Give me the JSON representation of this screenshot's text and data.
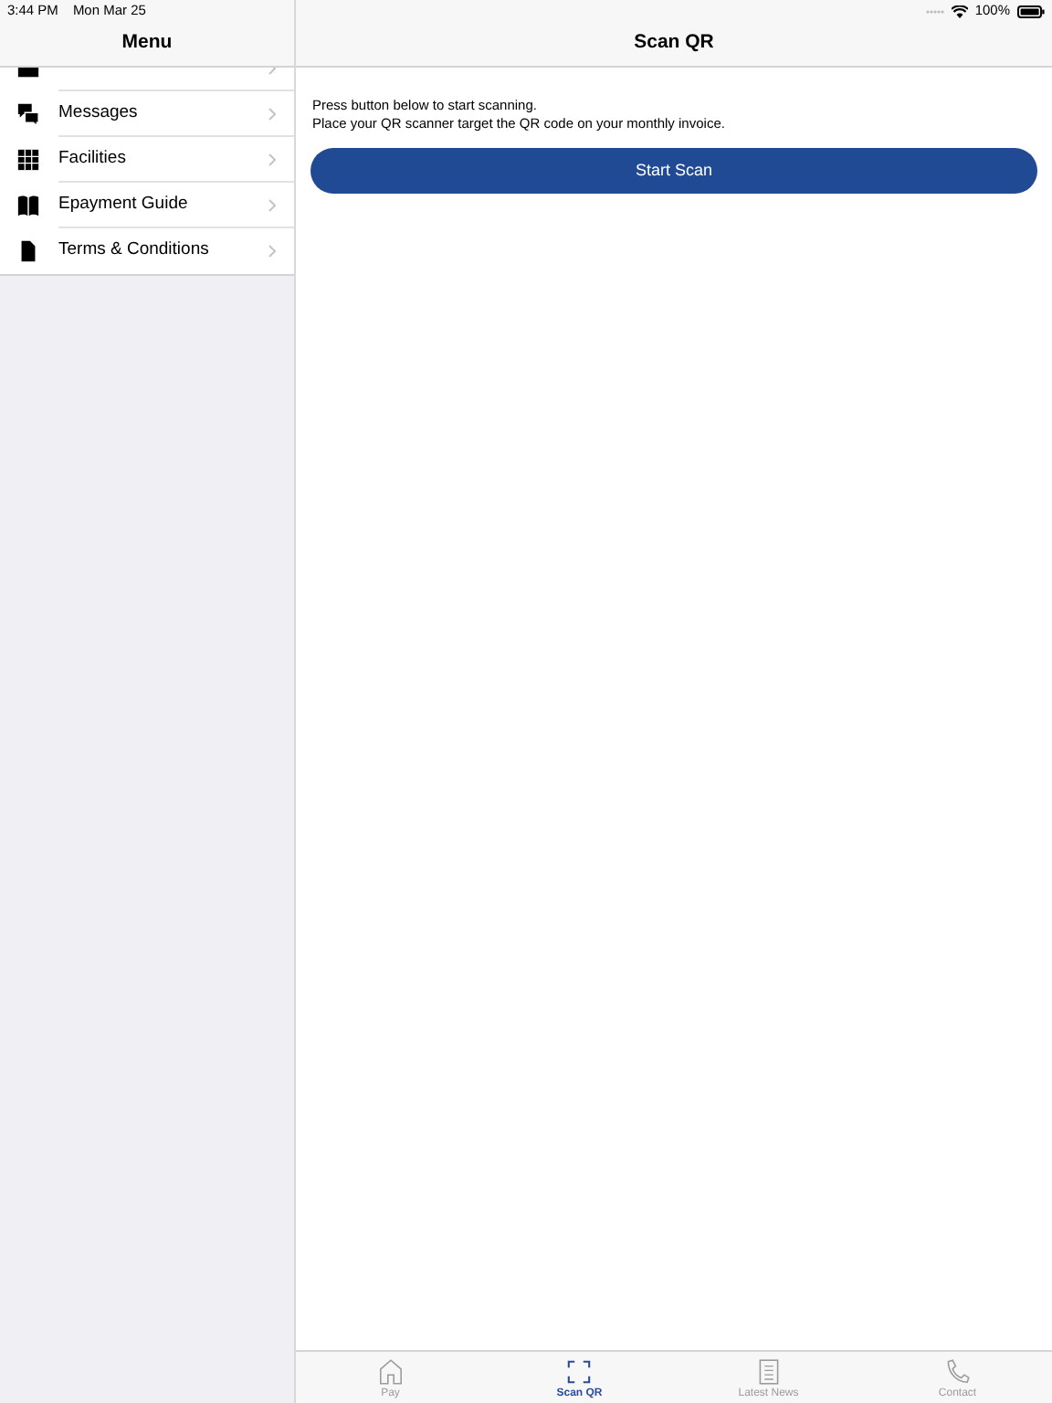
{
  "status_bar": {
    "time": "3:44 PM",
    "date": "Mon Mar 25",
    "battery": "100%"
  },
  "sidebar": {
    "title": "Menu",
    "items": [
      {
        "label": "Messages"
      },
      {
        "label": "Facilities"
      },
      {
        "label": "Epayment Guide"
      },
      {
        "label": "Terms & Conditions"
      }
    ]
  },
  "main": {
    "title": "Scan QR",
    "instructions": [
      "Press button below to start scanning.",
      "Place your QR scanner target the QR code on your monthly invoice."
    ],
    "button": "Start Scan"
  },
  "tab_bar": [
    {
      "label": "Pay",
      "selected": false
    },
    {
      "label": "Scan QR",
      "selected": true
    },
    {
      "label": "Latest News",
      "selected": false
    },
    {
      "label": "Contact",
      "selected": false
    }
  ]
}
